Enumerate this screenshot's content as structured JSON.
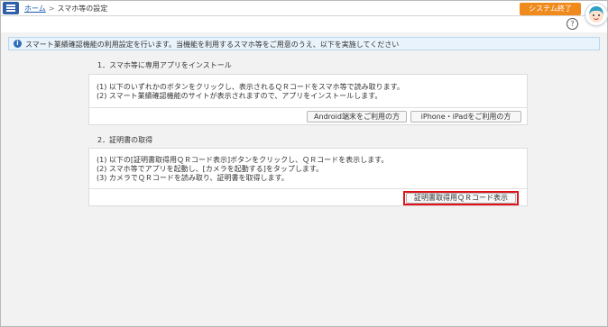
{
  "header": {
    "home_link": "ホーム",
    "separator": ">",
    "current_page": "スマホ等の設定",
    "exit_button": "システム終了",
    "help_icon": "?"
  },
  "info": {
    "icon": "i",
    "text": "スマート業績確認機能の利用設定を行います。当機能を利用するスマホ等をご用意のうえ、以下を実施してください"
  },
  "section1": {
    "title": "1．スマホ等に専用アプリをインストール",
    "lines": [
      "(1) 以下のいずれかのボタンをクリックし、表示されるＱＲコードをスマホ等で読み取ります。",
      "(2) スマート業績確認機能のサイトが表示されますので、アプリをインストールします。"
    ],
    "android_button": "Android端末をご利用の方",
    "iphone_button": "iPhone・iPadをご利用の方"
  },
  "section2": {
    "title": "2．証明書の取得",
    "lines": [
      "(1) 以下の[証明書取得用ＱＲコード表示]ボタンをクリックし、ＱＲコードを表示します。",
      "(2) スマホ等でアプリを起動し、[カメラを起動する]をタップします。",
      "(3) カメラでＱＲコードを読み取り、証明書を取得します。"
    ],
    "qr_button": "証明書取得用ＱＲコード表示"
  },
  "colors": {
    "menu": "#2f5fa8",
    "exit": "#f08a1c",
    "highlight": "#e0121b",
    "info_bg": "#e9f3fb"
  }
}
